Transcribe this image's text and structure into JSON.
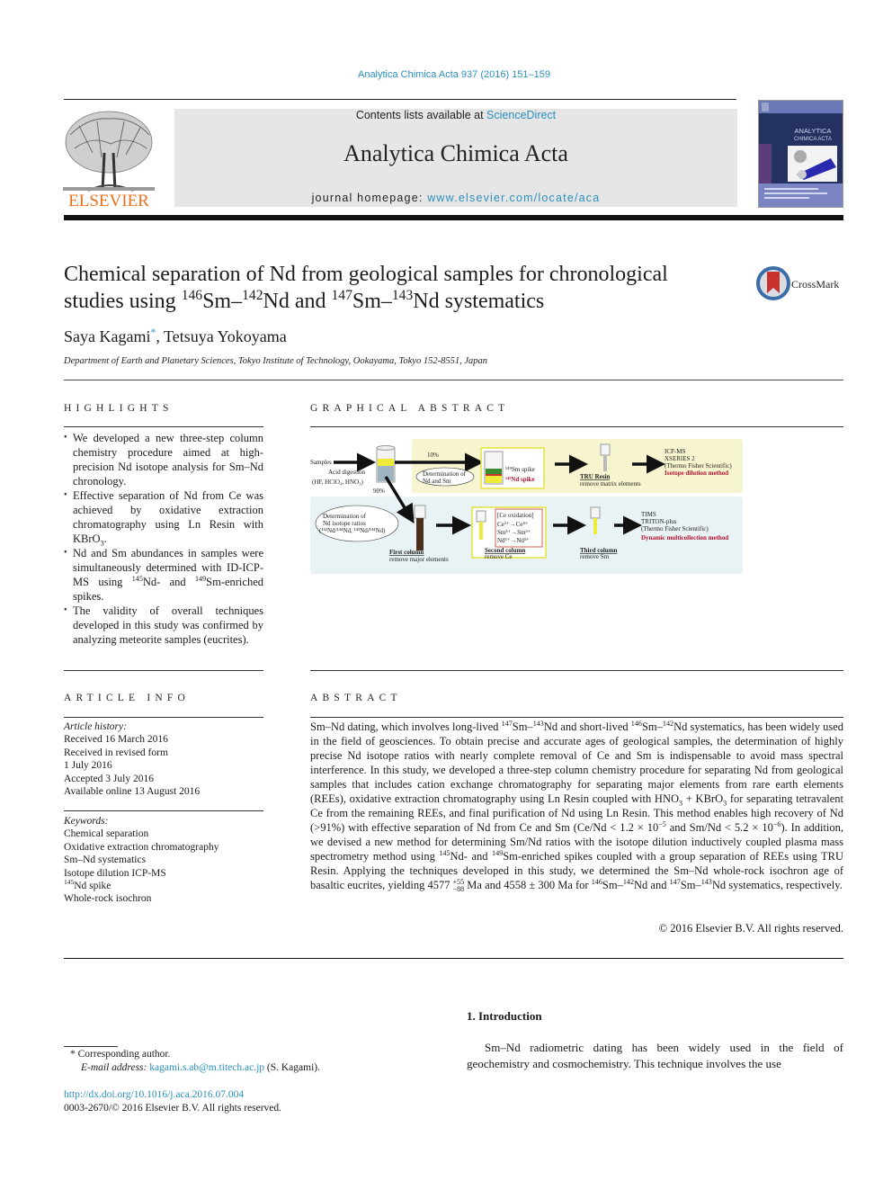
{
  "header": {
    "citation": "Analytica Chimica Acta 937 (2016) 151–159",
    "contents_prefix": "Contents lists available at ",
    "contents_link": "ScienceDirect",
    "journal_name": "Analytica Chimica Acta",
    "homepage_prefix": "journal homepage: ",
    "homepage_link": "www.elsevier.com/locate/aca",
    "publisher_logo_text": "ELSEVIER",
    "cover_title_1": "ANALYTICA",
    "cover_title_2": "CHIMICA ACTA",
    "crossmark_label": "CrossMark"
  },
  "article": {
    "title_line1": "Chemical separation of Nd from geological samples for chronological",
    "title_line2_a": "studies using ",
    "iso_146": "146",
    "sm": "Sm–",
    "iso_142": "142",
    "nd_and": "Nd and ",
    "iso_147": "147",
    "sm2": "Sm–",
    "iso_143": "143",
    "nd_sys": "Nd systematics",
    "author1": "Saya Kagami",
    "author1_mark": "*",
    "author_sep": ", ",
    "author2": "Tetsuya Yokoyama",
    "affiliation": "Department of Earth and Planetary Sciences, Tokyo Institute of Technology, Ookayama, Tokyo 152-8551, Japan"
  },
  "highlights": {
    "heading": "HIGHLIGHTS",
    "items": [
      "We developed a new three-step column chemistry procedure aimed at high-precision Nd isotope analysis for Sm–Nd chronology.",
      "Effective separation of Nd from Ce was achieved by oxidative extraction chromatography using Ln Resin with KBrO",
      "Nd and Sm abundances in samples were simultaneously determined with ID-ICP-MS using ",
      "The validity of overall techniques developed in this study was confirmed by analyzing meteorite samples (eucrites)."
    ],
    "item2_sub": "3",
    "item2_end": ".",
    "item3_iso1": "145",
    "item3_mid": "Nd- and ",
    "item3_iso2": "149",
    "item3_end": "Sm-enriched spikes."
  },
  "graphical_abstract": {
    "heading": "GRAPHICAL ABSTRACT",
    "samples": "Samples",
    "acid_digestion": "Acid digestion",
    "acids": "(HF, HClO₄, HNO₃)",
    "pct_10": "10%",
    "pct_90": "90%",
    "determination_ndsm_1": "Determination of",
    "determination_ndsm_2": "Nd and Sm",
    "sm_spike": "¹⁴⁹Sm spike",
    "nd_spike": "¹⁴⁵Nd spike",
    "tru_resin": "TRU Resin",
    "remove_matrix": "remove matrix elements",
    "icpms_1": "ICP-MS",
    "icpms_2": "XSERIES 2",
    "icpms_3": "(Thermo Fisher Scientific)",
    "isotope_dilution": "Isotope dilution method",
    "det_ratio_1": "Determination of",
    "det_ratio_2": "Nd isotope ratios",
    "det_ratio_3": "(¹⁴²Nd/¹⁴⁴Nd, ¹⁴³Nd/¹⁴⁴Nd)",
    "first_column": "First column",
    "remove_major": "remove major elements",
    "ce_oxidation": "[Ce oxidation]",
    "ce_eq": "Ce³⁺→Ce⁴⁺",
    "sm_eq": "Sm³⁺→Sm³⁺",
    "nd_eq": "Nd³⁺→Nd³⁺",
    "second_column": "Second column",
    "remove_ce": "remove Ce",
    "third_column": "Third column",
    "remove_sm": "remove Sm",
    "tims_1": "TIMS",
    "tims_2": "TRITON-plus",
    "tims_3": "(Thermo Fisher Scientific)",
    "dynamic": "Dynamic multicollection method",
    "colors": {
      "yellow_bg": "#f7f5cf",
      "blue_bg": "#e9f2f5",
      "red": "#b3122e"
    }
  },
  "article_info": {
    "heading": "ARTICLE INFO",
    "history_label": "Article history:",
    "history": [
      "Received 16 March 2016",
      "Received in revised form",
      "1 July 2016",
      "Accepted 3 July 2016",
      "Available online 13 August 2016"
    ],
    "keywords_label": "Keywords:",
    "keywords": [
      "Chemical separation",
      "Oxidative extraction chromatography",
      "Sm–Nd systematics",
      "Isotope dilution ICP-MS",
      "Nd spike",
      "Whole-rock isochron"
    ],
    "kw5_iso": "145"
  },
  "abstract": {
    "heading": "ABSTRACT",
    "p1": "Sm–Nd dating, which involves long-lived ",
    "p2": "Sm–",
    "p3": "Nd and short-lived ",
    "p4": "Sm–",
    "p5": "Nd systematics, has been widely used in the field of geosciences. To obtain precise and accurate ages of geological samples, the determination of highly precise Nd isotope ratios with nearly complete removal of Ce and Sm is indispensable to avoid mass spectral interference. In this study, we developed a three-step column chemistry procedure for separating Nd from geological samples that includes cation exchange chromatography for separating major elements from rare earth elements (REEs), oxidative extraction chromatography using Ln Resin coupled with HNO",
    "p6": " + KBrO",
    "p7": " for separating tetravalent Ce from the remaining REEs, and final purification of Nd using Ln Resin. This method enables high recovery of Nd (>91%) with effective separation of Nd from Ce and Sm (Ce/Nd < 1.2 × 10",
    "p8": " and Sm/Nd < 5.2 × 10",
    "p9": "). In addition, we devised a new method for determining Sm/Nd ratios with the isotope dilution inductively coupled plasma mass spectrometry method using ",
    "p10": "Nd- and ",
    "p11": "Sm-enriched spikes coupled with a group separation of REEs using TRU Resin. Applying the techniques developed in this study, we determined the Sm–Nd whole-rock isochron age of basaltic eucrites, yielding 4577 ",
    "p12": " Ma and 4558 ± 300 Ma for ",
    "p13": "Sm–",
    "p14": "Nd and ",
    "p15": "Sm–",
    "p16": "Nd systematics, respectively.",
    "s147": "147",
    "s143": "143",
    "s146": "146",
    "s142": "142",
    "s145": "145",
    "s149": "149",
    "sub3": "3",
    "exp5": "−5",
    "exp6": "−6",
    "err_plus": "+55",
    "err_minus": "−88",
    "copyright": "© 2016 Elsevier B.V. All rights reserved."
  },
  "footnotes": {
    "corr_mark": "*",
    "corr_text": " Corresponding author.",
    "email_label": "E-mail address: ",
    "email": "kagami.s.ab@m.titech.ac.jp",
    "email_suffix": " (S. Kagami).",
    "doi": "http://dx.doi.org/10.1016/j.aca.2016.07.004",
    "issn": "0003-2670/© 2016 Elsevier B.V. All rights reserved."
  },
  "introduction": {
    "heading": "1.  Introduction",
    "text": "Sm–Nd radiometric dating has been widely used in the field of geochemistry and cosmochemistry. This technique involves the use"
  }
}
